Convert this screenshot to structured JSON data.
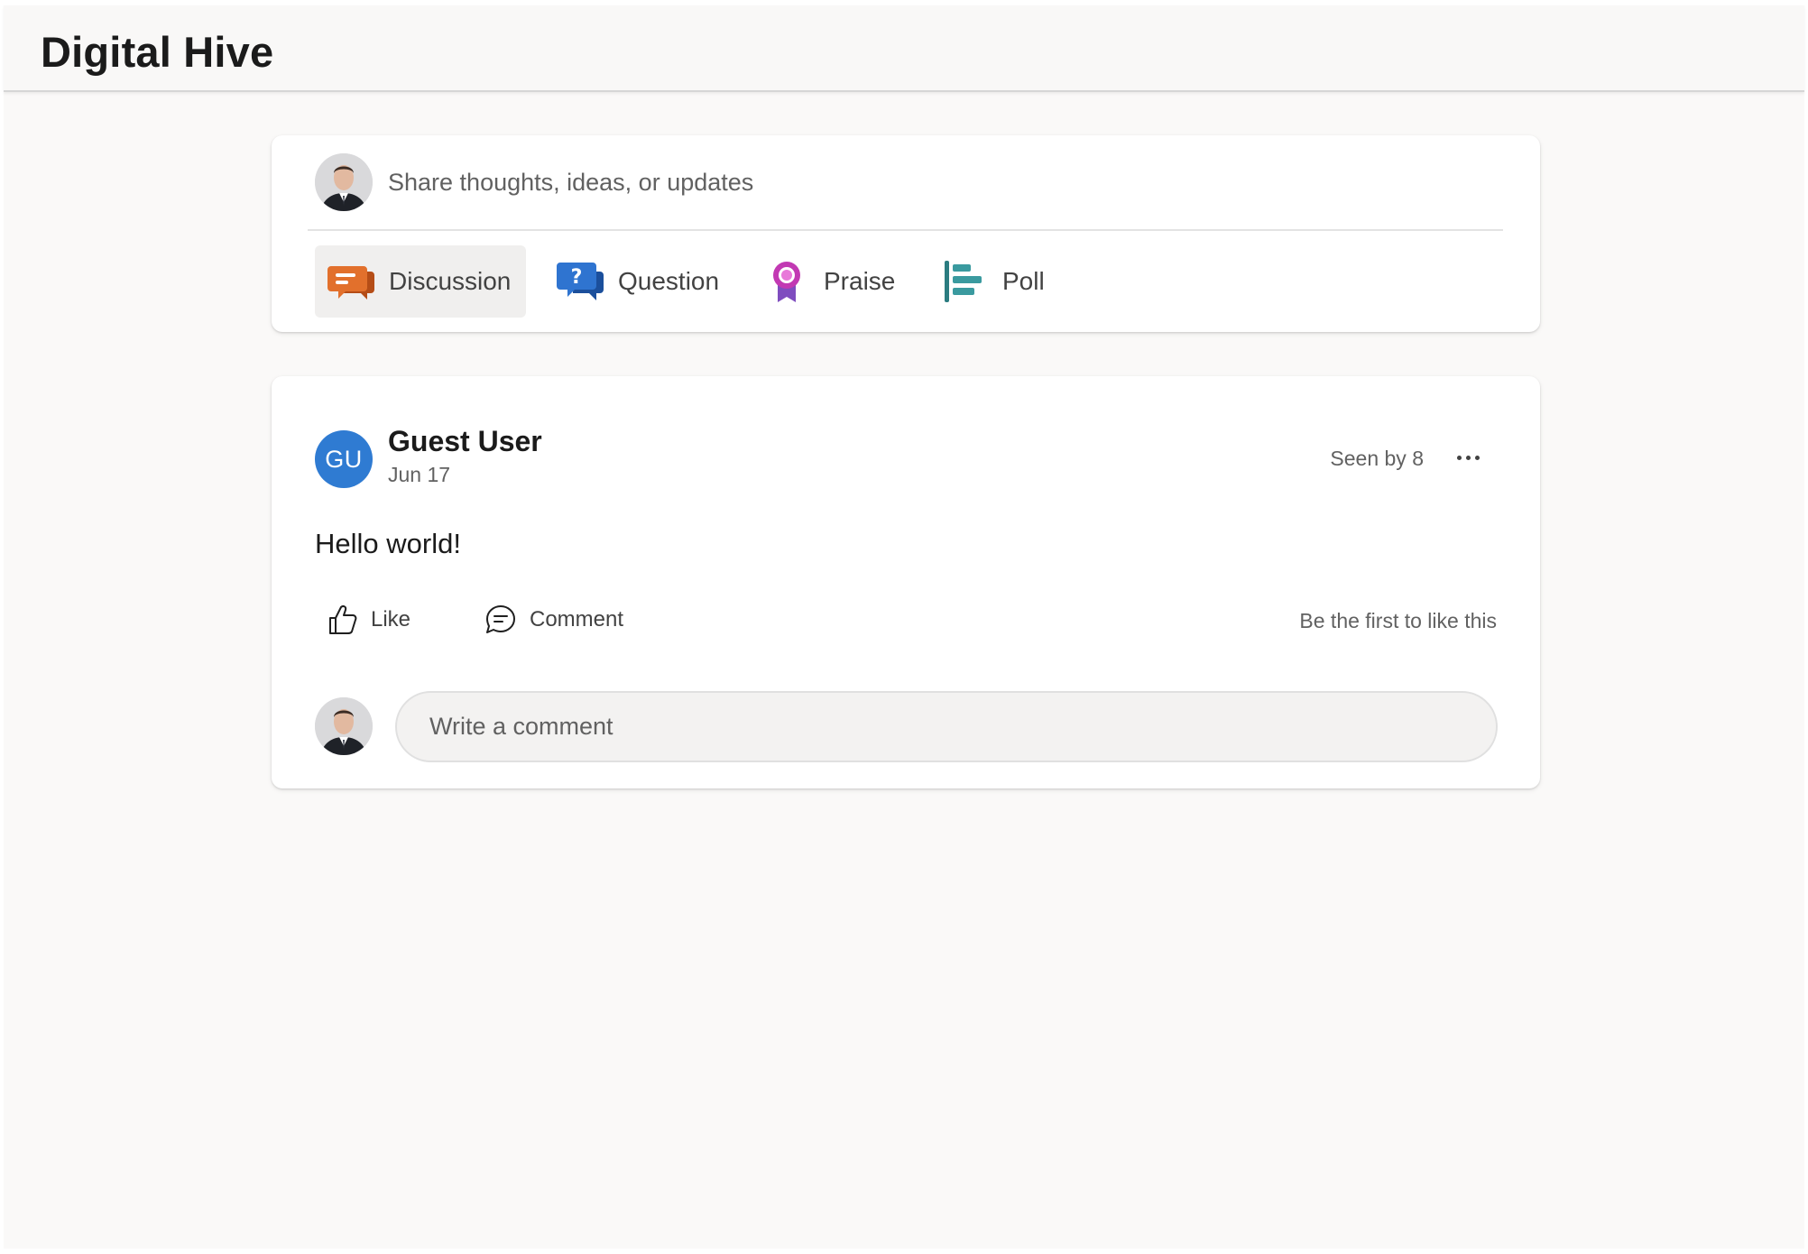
{
  "app": {
    "title": "Digital Hive"
  },
  "composer": {
    "placeholder": "Share thoughts, ideas, or updates",
    "post_types": [
      {
        "label": "Discussion",
        "icon": "discussion-icon",
        "color": "#e2702c",
        "active": true
      },
      {
        "label": "Question",
        "icon": "question-icon",
        "color": "#2f74d0",
        "active": false
      },
      {
        "label": "Praise",
        "icon": "praise-icon",
        "color": "#c239b3",
        "active": false
      },
      {
        "label": "Poll",
        "icon": "poll-icon",
        "color": "#3a9a9f",
        "active": false
      }
    ]
  },
  "post": {
    "author": {
      "name": "Guest User",
      "initials": "GU",
      "avatar_color": "#2f7bd2"
    },
    "date": "Jun 17",
    "seen_by": "Seen by 8",
    "body": "Hello world!",
    "actions": {
      "like": "Like",
      "comment": "Comment"
    },
    "likes_summary": "Be the first to like this",
    "comment_placeholder": "Write a comment"
  }
}
